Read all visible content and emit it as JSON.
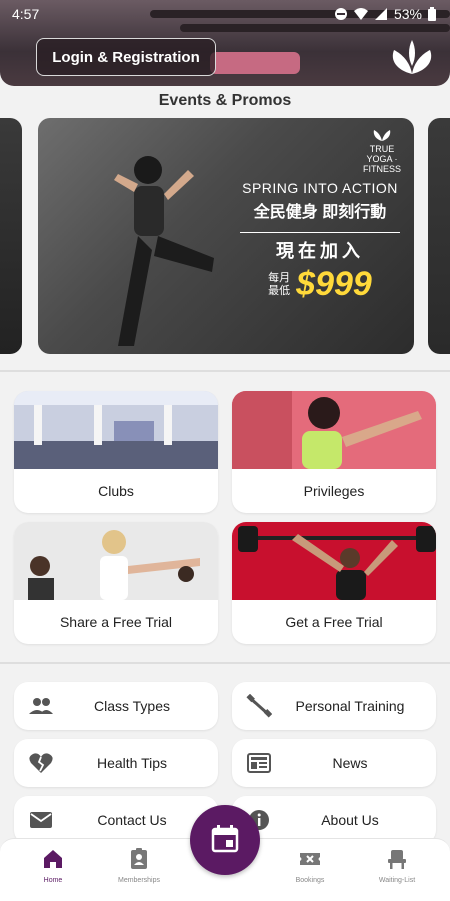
{
  "status_bar": {
    "time": "4:57",
    "battery": "53%"
  },
  "header": {
    "login_label": "Login & Registration"
  },
  "events": {
    "title": "Events & Promos",
    "promo": {
      "brand": "TRUE YOGA · FITNESS",
      "headline_en": "SPRING INTO ACTION",
      "headline_zh": "全民健身 即刻行動",
      "join_zh": "現在加入",
      "monthly_line1": "每月",
      "monthly_line2": "最低",
      "price": "$999"
    }
  },
  "tiles": [
    {
      "label": "Clubs"
    },
    {
      "label": "Privileges"
    },
    {
      "label": "Share a Free Trial"
    },
    {
      "label": "Get a Free Trial"
    }
  ],
  "links": [
    {
      "label": "Class Types",
      "icon": "people-icon"
    },
    {
      "label": "Personal Training",
      "icon": "dumbbell-icon"
    },
    {
      "label": "Health Tips",
      "icon": "broken-heart-icon"
    },
    {
      "label": "News",
      "icon": "news-icon"
    },
    {
      "label": "Contact Us",
      "icon": "mail-icon"
    },
    {
      "label": "About Us",
      "icon": "info-icon"
    }
  ],
  "nav": {
    "home": "Home",
    "memberships": "Memberships",
    "bookings": "Bookings",
    "waiting_list": "Waiting-List"
  },
  "colors": {
    "accent": "#5b1a63",
    "price": "#ffd93a"
  }
}
